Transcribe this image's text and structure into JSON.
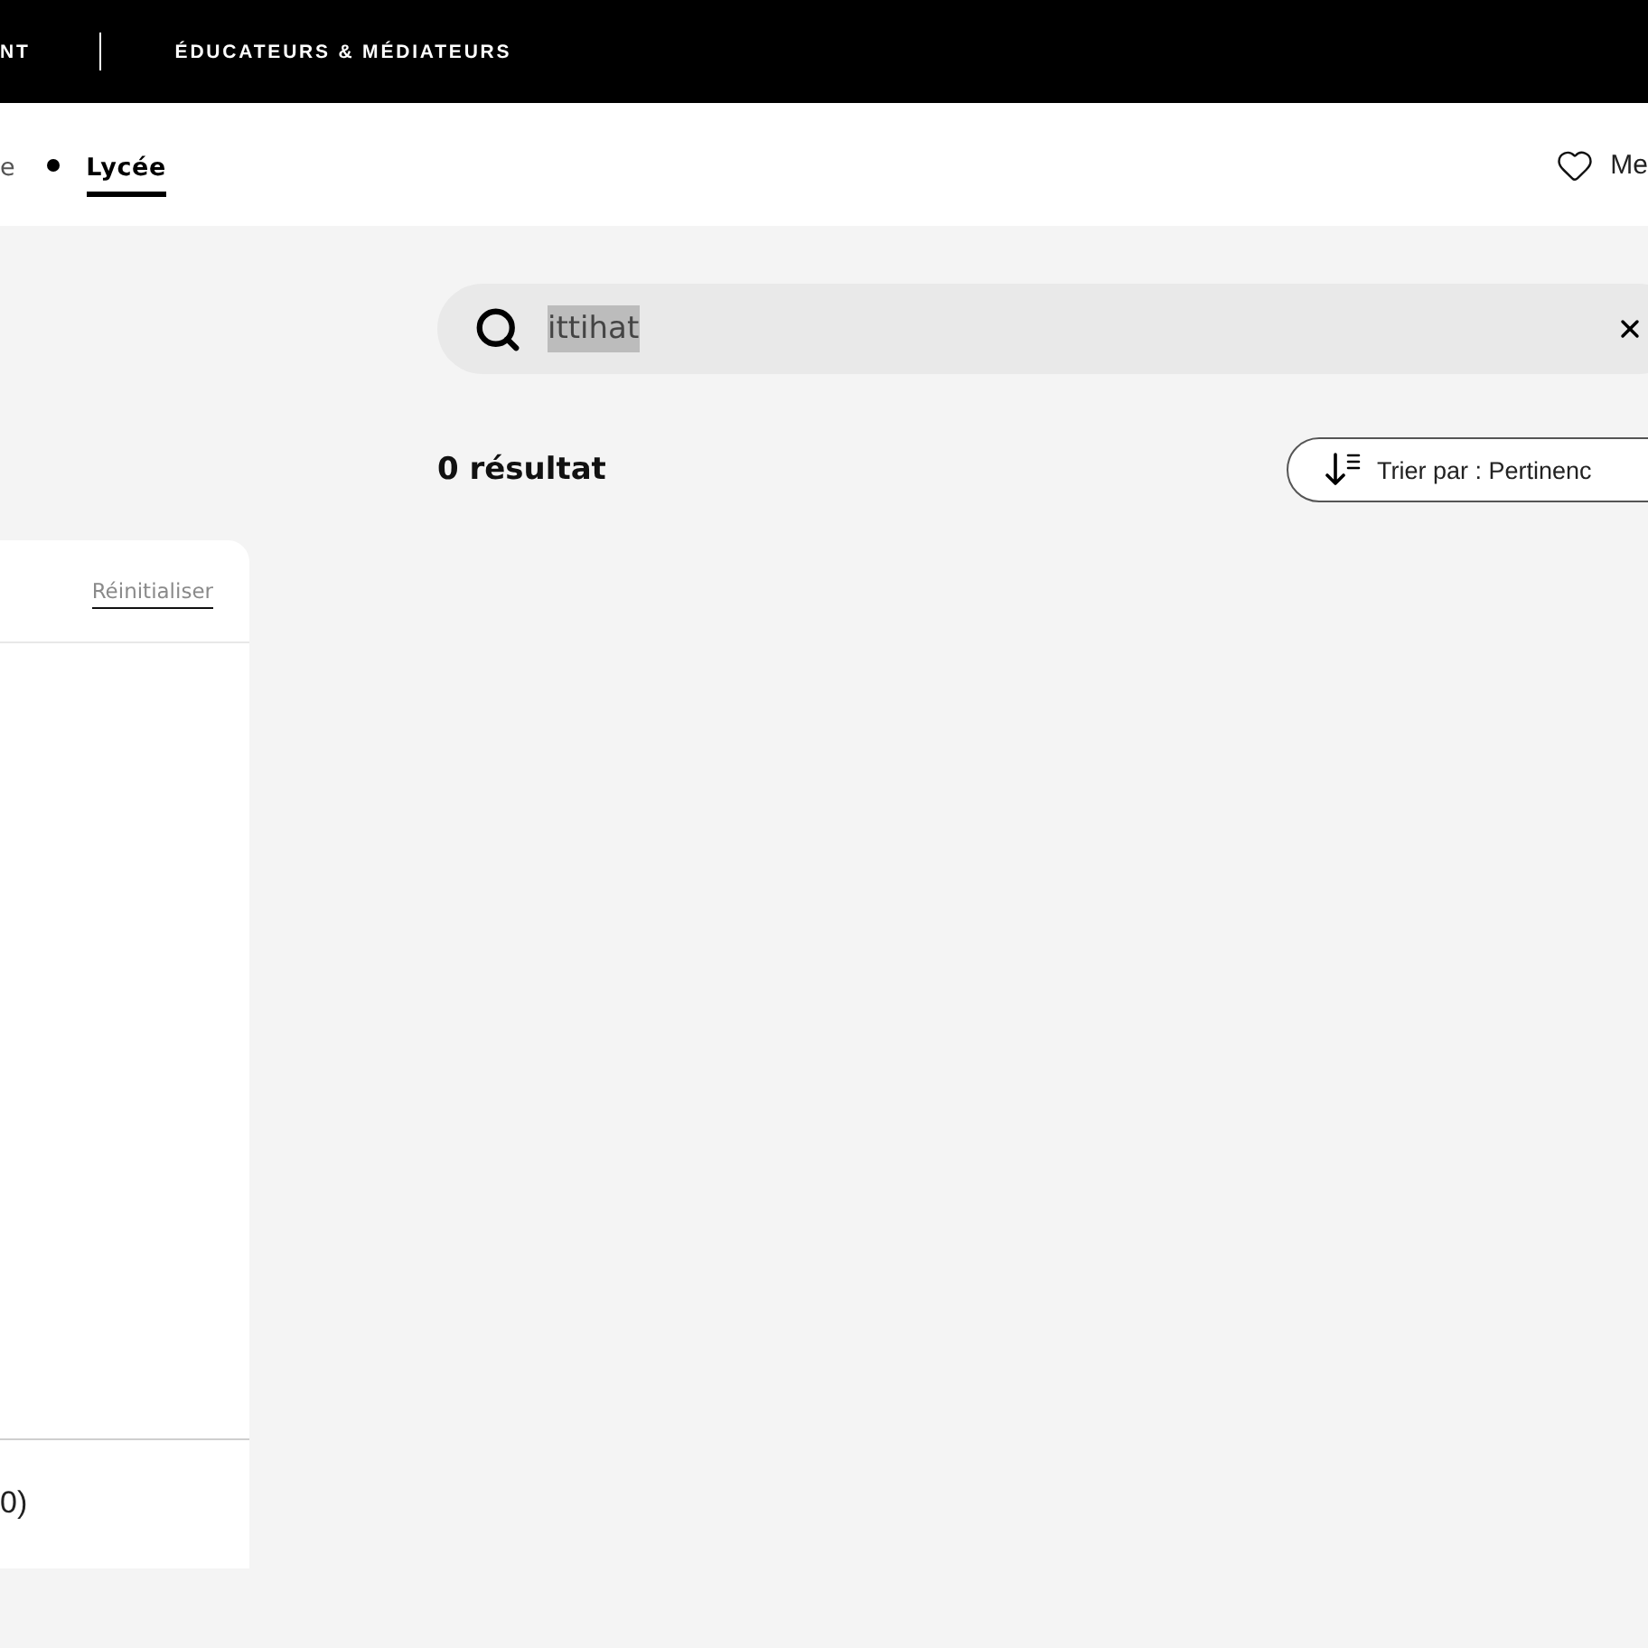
{
  "top_nav": {
    "items": [
      {
        "label": "NT"
      },
      {
        "label": "ÉDUCATEURS & MÉDIATEURS"
      }
    ]
  },
  "sub_nav": {
    "tabs": [
      {
        "label": "e",
        "selected": false
      },
      {
        "label": "Lycée",
        "selected": true
      }
    ],
    "favorites": {
      "label": "Me"
    }
  },
  "filters": {
    "reset_link": "Réinitialiser",
    "footer": "0)"
  },
  "search": {
    "value": "ittihat",
    "text_selected": true
  },
  "results": {
    "count": "0 résultat",
    "sort_button": "Trier par : Pertinenc"
  }
}
